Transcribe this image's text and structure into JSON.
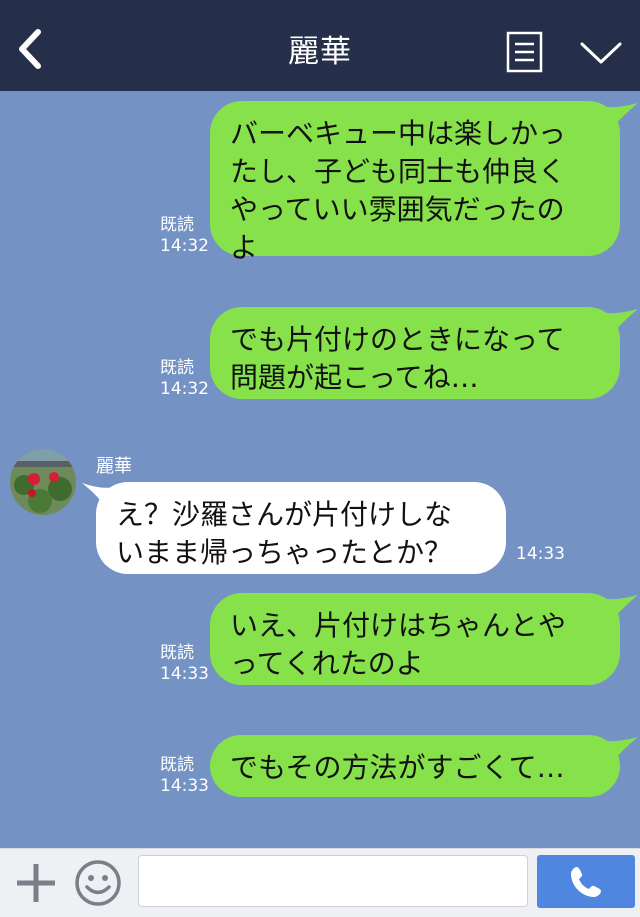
{
  "header": {
    "title": "麗華",
    "icons": {
      "back": "chevron-left-icon",
      "menu": "menu-list-icon",
      "collapse": "chevron-down-icon"
    }
  },
  "messages": [
    {
      "side": "me",
      "lines": [
        "バーベキュー中は楽しかっ",
        "たし、子ども同士も仲良く",
        "やっていい雰囲気だったの",
        "よ"
      ],
      "read": "既読",
      "time": "14:32"
    },
    {
      "side": "me",
      "lines": [
        "でも片付けのときになって",
        "問題が起こってね…"
      ],
      "read": "既読",
      "time": "14:32"
    },
    {
      "side": "them",
      "sender": "麗華",
      "lines": [
        "え？沙羅さんが片付けしな",
        "いまま帰っちゃったとか？"
      ],
      "time": "14:33"
    },
    {
      "side": "me",
      "lines": [
        "いえ、片付けはちゃんとや",
        "ってくれたのよ"
      ],
      "read": "既読",
      "time": "14:33"
    },
    {
      "side": "me",
      "lines": [
        "でもその方法がすごくて…"
      ],
      "read": "既読",
      "time": "14:33"
    }
  ],
  "footer": {
    "input_placeholder": "",
    "icons": {
      "add": "plus-icon",
      "emoji": "smile-icon",
      "send": "phone-icon"
    }
  },
  "colors": {
    "header": "#252f49",
    "background": "#7492c4",
    "my_bubble": "#86e14b",
    "their_bubble": "#ffffff",
    "send_button": "#4f86df"
  }
}
